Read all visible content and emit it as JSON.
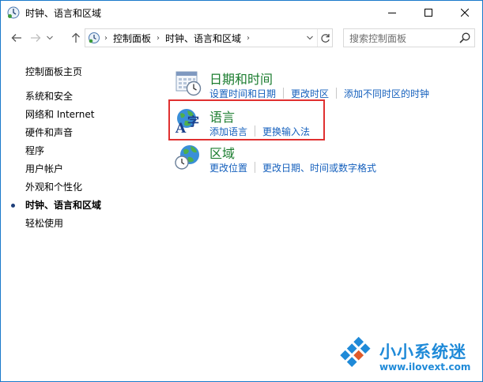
{
  "window": {
    "title": "时钟、语言和区域",
    "minimize_glyph": "—",
    "maximize_glyph": "☐",
    "close_glyph": "✕"
  },
  "navigation": {
    "back_icon": "arrow-left-icon",
    "forward_icon": "arrow-right-icon",
    "up_icon": "arrow-up-icon"
  },
  "address_bar": {
    "breadcrumbs": [
      "控制面板",
      "时钟、语言和区域"
    ],
    "separator": "›"
  },
  "search": {
    "placeholder": "搜索控制面板"
  },
  "left_nav": {
    "home": "控制面板主页",
    "items": [
      {
        "label": "系统和安全",
        "active": false
      },
      {
        "label": "网络和 Internet",
        "active": false
      },
      {
        "label": "硬件和声音",
        "active": false
      },
      {
        "label": "程序",
        "active": false
      },
      {
        "label": "用户帐户",
        "active": false
      },
      {
        "label": "外观和个性化",
        "active": false
      },
      {
        "label": "时钟、语言和区域",
        "active": true
      },
      {
        "label": "轻松使用",
        "active": false
      }
    ]
  },
  "categories": [
    {
      "title": "日期和时间",
      "icon": "calendar-clock-icon",
      "links": [
        "设置时间和日期",
        "更改时区",
        "添加不同时区的时钟"
      ]
    },
    {
      "title": "语言",
      "icon": "language-globe-icon",
      "links": [
        "添加语言",
        "更换输入法"
      ],
      "highlighted": true
    },
    {
      "title": "区域",
      "icon": "region-globe-icon",
      "links": [
        "更改位置",
        "更改日期、时间或数字格式"
      ]
    }
  ],
  "watermark": {
    "brand": "小小系统迷",
    "url": "www.ilovext.com"
  },
  "colors": {
    "category_title": "#1a7c2e",
    "link": "#1560bd",
    "highlight_border": "#e03030",
    "watermark": "#1f8ad8"
  }
}
